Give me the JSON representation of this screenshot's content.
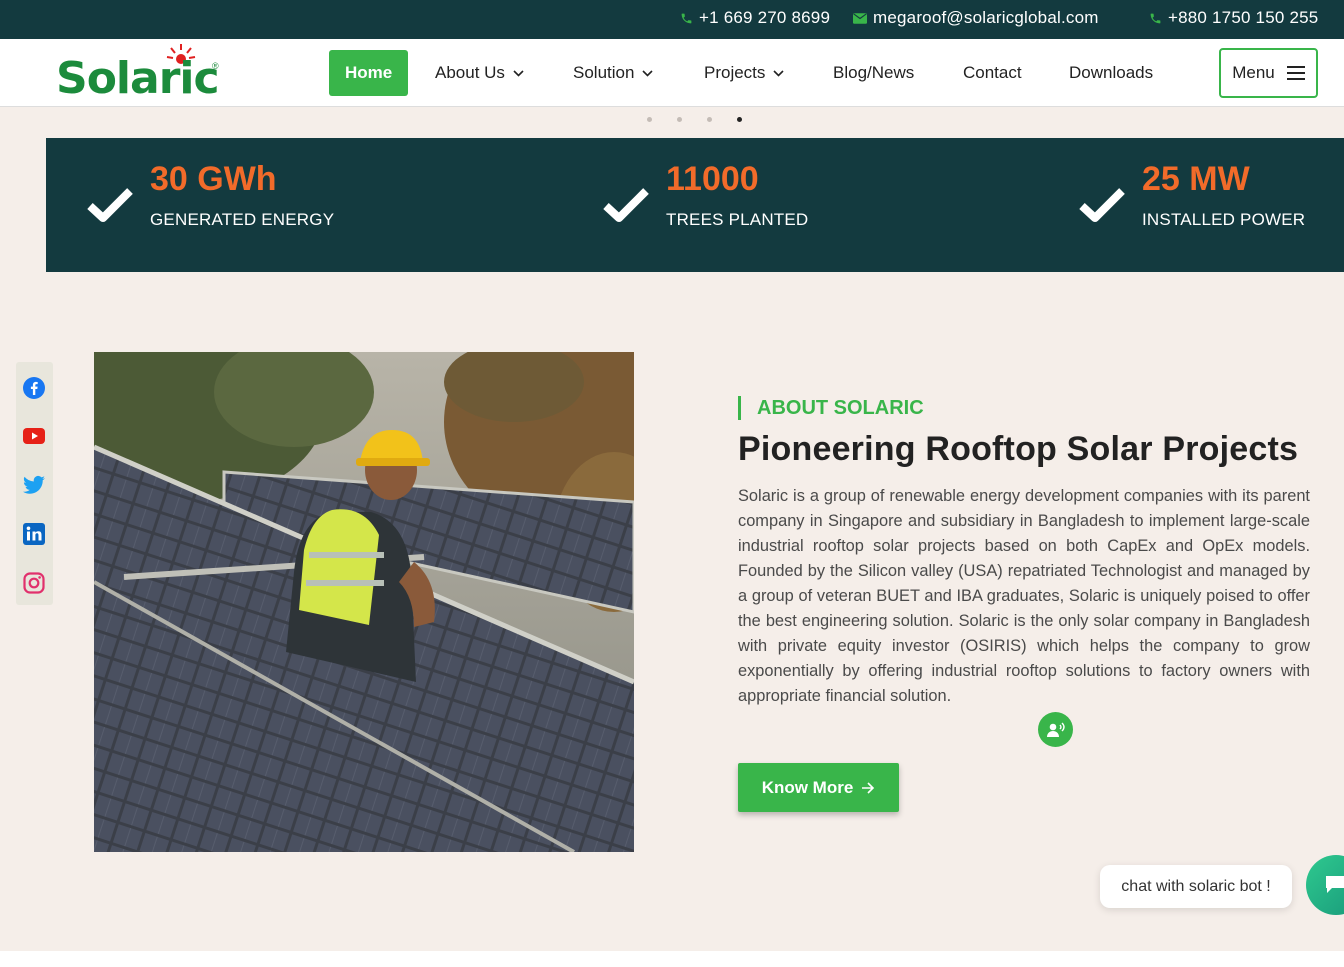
{
  "topbar": {
    "phone1": "+1 669 270 8699",
    "email": "megaroof@solaricglobal.com",
    "phone2": "+880 1750 150 255"
  },
  "header": {
    "logo_text": "Solaric",
    "logo_mark": "®",
    "nav": {
      "home": "Home",
      "about": "About Us",
      "solution": "Solution",
      "projects": "Projects",
      "blog": "Blog/News",
      "contact": "Contact",
      "downloads": "Downloads"
    },
    "menu_label": "Menu"
  },
  "carousel": {
    "slides": 4,
    "active_slide": 4
  },
  "stats": [
    {
      "value": "30 GWh",
      "label": "GENERATED ENERGY"
    },
    {
      "value": "11000",
      "label": "TREES PLANTED"
    },
    {
      "value": "25 MW",
      "label": "INSTALLED POWER"
    }
  ],
  "social": [
    "facebook-icon",
    "youtube-icon",
    "twitter-icon",
    "linkedin-icon",
    "instagram-icon"
  ],
  "about": {
    "tag": "ABOUT SOLARIC",
    "title": "Pioneering Rooftop Solar Projects",
    "body": "Solaric is a group of renewable energy development companies with its parent company in Singapore and subsidiary in Bangladesh to implement large-scale industrial rooftop solar projects based on both CapEx and OpEx models. Founded by the Silicon valley (USA) repatriated Technologist and managed by a group of veteran BUET and IBA graduates, Solaric is uniquely poised to offer the best engineering solution. Solaric is the only solar company in Bangladesh with private equity investor (OSIRIS) which helps the company to grow exponentially by offering industrial rooftop solutions to factory owners with appropriate financial solution.",
    "button": "Know More"
  },
  "chat": {
    "label": "chat with solaric bot !"
  },
  "colors": {
    "dark_teal": "#133a3f",
    "green": "#39b54a",
    "orange": "#f26b2a",
    "background": "#f5eee9"
  }
}
